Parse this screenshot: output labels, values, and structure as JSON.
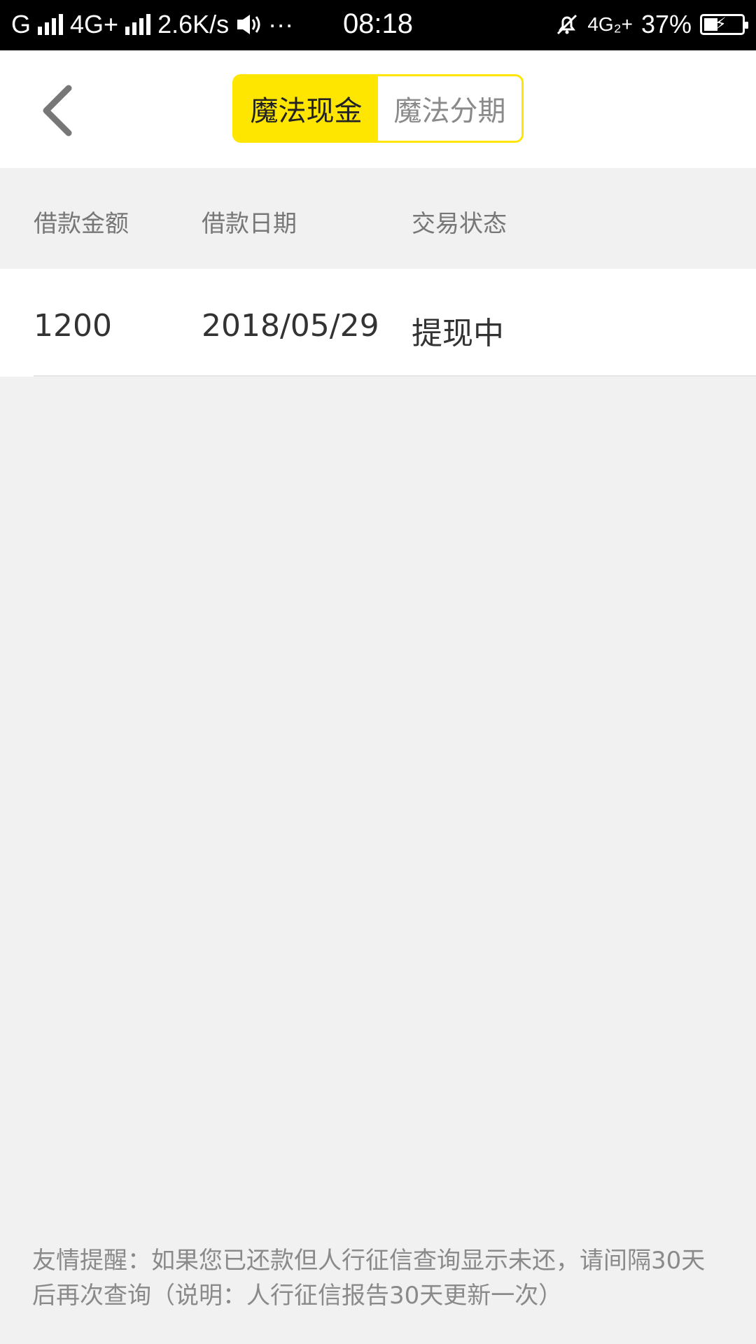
{
  "status_bar": {
    "carrier1": "G",
    "network": "4G+",
    "speed": "2.6K/s",
    "more": "···",
    "time": "08:18",
    "network2": "4G₂+",
    "battery_percent": "37%",
    "battery_level": 0.37
  },
  "header": {
    "tabs": [
      {
        "label": "魔法现金",
        "active": true
      },
      {
        "label": "魔法分期",
        "active": false
      }
    ],
    "accent_color": "#ffe600"
  },
  "table": {
    "columns": [
      "借款金额",
      "借款日期",
      "交易状态"
    ],
    "rows": [
      {
        "amount": "1200",
        "date": "2018/05/29",
        "status": "提现中"
      }
    ]
  },
  "notice": {
    "text": "友情提醒：如果您已还款但人行征信查询显示未还，请间隔30天后再次查询（说明：人行征信报告30天更新一次）"
  }
}
